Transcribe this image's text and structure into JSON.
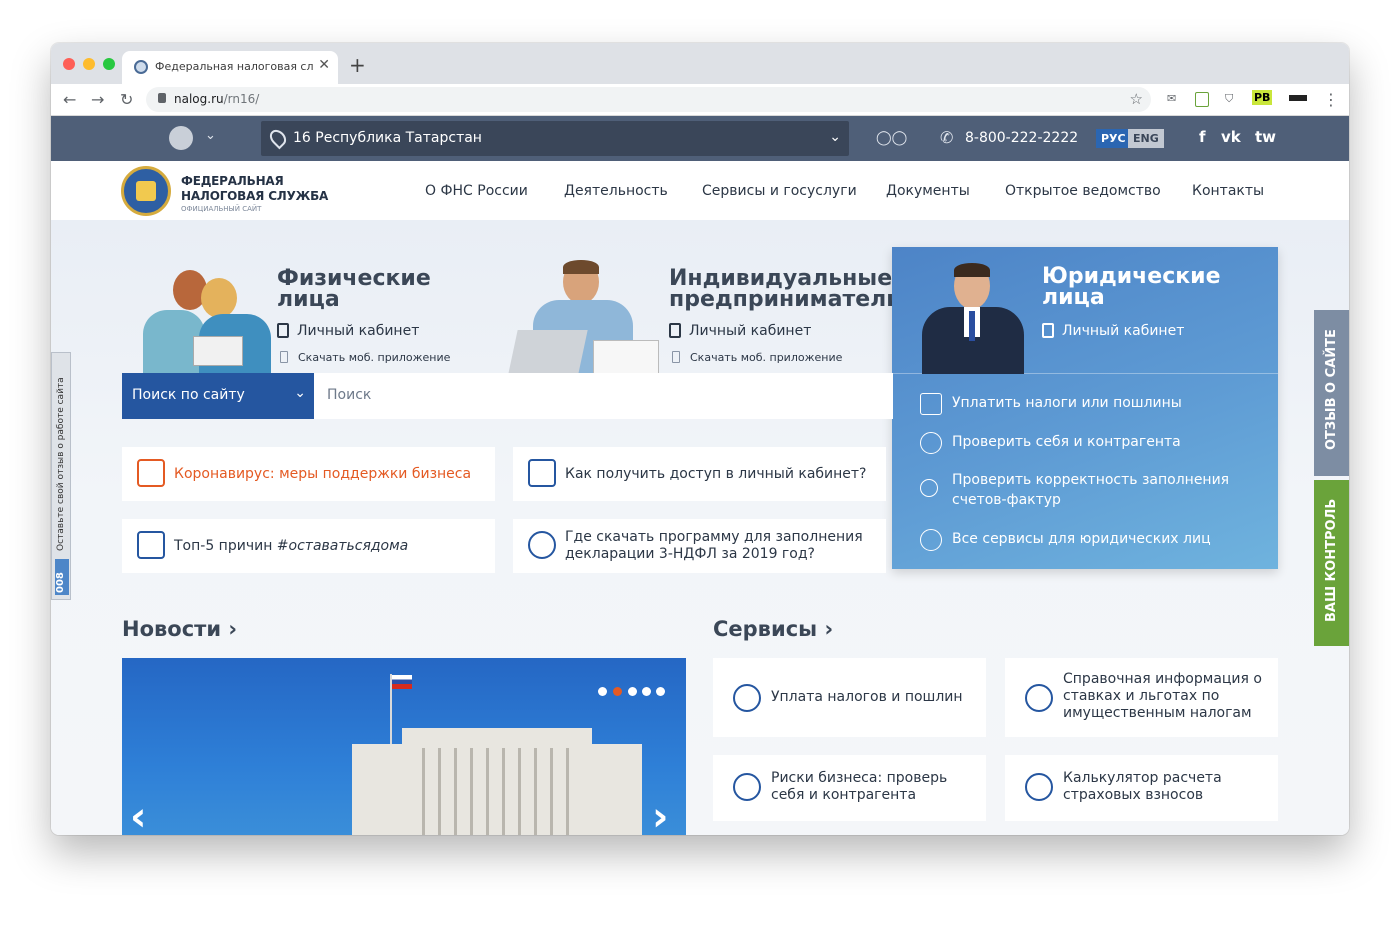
{
  "browser": {
    "tab_title": "Федеральная налоговая служба",
    "url_host": "nalog.ru",
    "url_path": "/rn16/",
    "ext_pb": "PB"
  },
  "topbar": {
    "region": "16 Республика Татарстан",
    "phone": "8-800-222-2222",
    "lang_ru": "РУС",
    "lang_en": "ENG",
    "social_fb": "f",
    "social_vk": "vk",
    "social_tw": "tw"
  },
  "logo": {
    "line1": "ФЕДЕРАЛЬНАЯ",
    "line2": "НАЛОГОВАЯ СЛУЖБА",
    "line3": "ОФИЦИАЛЬНЫЙ САЙТ"
  },
  "menu": [
    "О ФНС России",
    "Деятельность",
    "Сервисы и госуслуги",
    "Документы",
    "Открытое ведомство",
    "Контакты"
  ],
  "audiences": {
    "fiz": {
      "title1": "Физические",
      "title2": "лица",
      "cabinet": "Личный кабинет",
      "app": "Скачать моб. приложение"
    },
    "ip": {
      "title1": "Индивидуальные",
      "title2": "предприниматели",
      "cabinet": "Личный кабинет",
      "app": "Скачать моб. приложение"
    },
    "yur": {
      "title1": "Юридические",
      "title2": "лица",
      "cabinet": "Личный кабинет"
    }
  },
  "yur_links": [
    "Уплатить налоги или пошлины",
    "Проверить себя и контрагента",
    "Проверить корректность заполнения",
    "счетов-фактур",
    "Все сервисы для юридических лиц"
  ],
  "search": {
    "select": "Поиск по сайту",
    "placeholder": "Поиск"
  },
  "quick": {
    "covid": "Коронавирус: меры поддержки бизнеса",
    "access": "Как получить доступ в личный кабинет?",
    "top5_plain": "Топ-5 причин ",
    "top5_tag": "#оставатьсядома",
    "download1": "Где скачать программу для заполнения",
    "download2": "декларации 3-НДФЛ за 2019 год?"
  },
  "sections": {
    "news": "Новости",
    "services": "Сервисы"
  },
  "services": {
    "pay": "Уплата налогов и пошлин",
    "ref1": "Справочная информация о",
    "ref2": "ставках и льготах по",
    "ref3": "имущественным налогам",
    "risk1": "Риски бизнеса: проверь",
    "risk2": "себя и контрагента",
    "calc1": "Калькулятор расчета",
    "calc2": "страховых взносов"
  },
  "side": {
    "feedback_left": "Оставьте свой отзыв о работе сайта",
    "feedback_code": "008",
    "otzyv": "ОТЗЫВ О САЙТЕ",
    "control": "ВАШ КОНТРОЛЬ"
  },
  "colors": {
    "accent": "#2556a0",
    "topbar": "#4f5f78",
    "covid": "#e45a23",
    "control": "#6aa33a",
    "otzyv": "#7d8da3"
  }
}
